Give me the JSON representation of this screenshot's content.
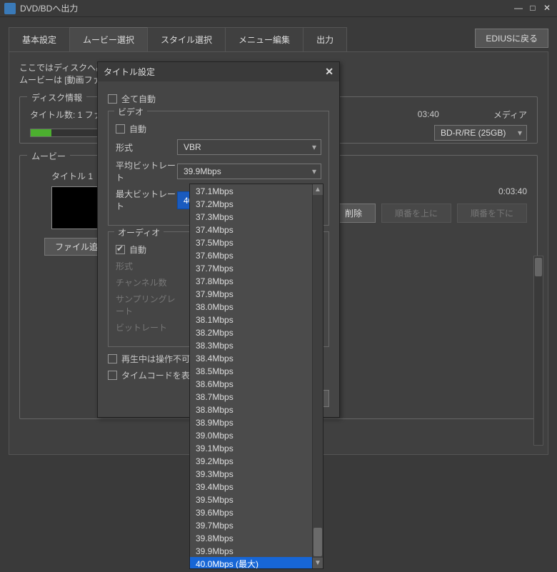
{
  "window": {
    "title": "DVD/BDへ出力"
  },
  "tabs": {
    "basic": "基本設定",
    "movie": "ムービー選択",
    "style": "スタイル選択",
    "menu": "メニュー編集",
    "output": "出力"
  },
  "edius_return": "EDIUSに戻る",
  "description": {
    "line1": "ここではディスクへ出力した",
    "line2": "ムービーは [動画ファイル]"
  },
  "disc_group": {
    "title": "ディスク情報",
    "titles_label": "タイトル数: 1   ファ",
    "time": "03:40",
    "media_label": "メディア",
    "media_value": "BD-R/RE (25GB)"
  },
  "movie_group": {
    "title": "ムービー",
    "title1": "タイトル 1",
    "duration": "0:03:40",
    "delete_btn": "削除",
    "move_up_btn": "順番を上に",
    "move_down_btn": "順番を下に",
    "file_add_btn": "ファイル追加"
  },
  "dialog": {
    "title": "タイトル設定",
    "all_auto": "全て自動",
    "video_group": "ビデオ",
    "video_auto": "自動",
    "format_label": "形式",
    "format_value": "VBR",
    "avg_bitrate_label": "平均ビットレート",
    "avg_bitrate_value": "39.9Mbps",
    "max_bitrate_label": "最大ビットレート",
    "max_bitrate_value": "40.0Mbps (最大)",
    "audio_group": "オーディオ",
    "audio_auto": "自動",
    "audio_format_label": "形式",
    "channels_label": "チャンネル数",
    "sampling_label": "サンプリングレート",
    "bitrate_label": "ビットレート",
    "no_op_playback": "再生中は操作不可",
    "show_timecode": "タイムコードを表示",
    "ok_btn": "O"
  },
  "dropdown_items": [
    "37.1Mbps",
    "37.2Mbps",
    "37.3Mbps",
    "37.4Mbps",
    "37.5Mbps",
    "37.6Mbps",
    "37.7Mbps",
    "37.8Mbps",
    "37.9Mbps",
    "38.0Mbps",
    "38.1Mbps",
    "38.2Mbps",
    "38.3Mbps",
    "38.4Mbps",
    "38.5Mbps",
    "38.6Mbps",
    "38.7Mbps",
    "38.8Mbps",
    "38.9Mbps",
    "39.0Mbps",
    "39.1Mbps",
    "39.2Mbps",
    "39.3Mbps",
    "39.4Mbps",
    "39.5Mbps",
    "39.6Mbps",
    "39.7Mbps",
    "39.8Mbps",
    "39.9Mbps",
    "40.0Mbps (最大)"
  ],
  "dropdown_selected_index": 29
}
